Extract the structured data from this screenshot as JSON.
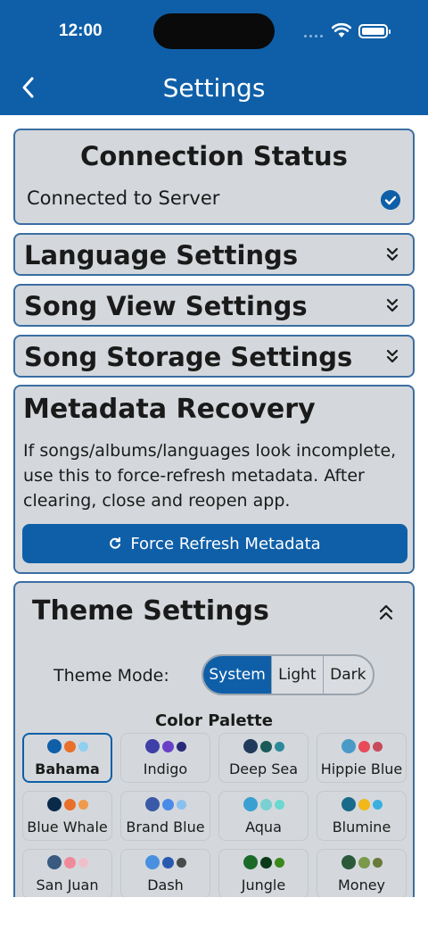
{
  "status_bar": {
    "time": "12:00"
  },
  "nav": {
    "title": "Settings",
    "back_icon": "chevron-left-icon"
  },
  "connection": {
    "title": "Connection Status",
    "status_text": "Connected to Server",
    "status_icon": "check-circle-icon"
  },
  "sections": {
    "language": "Language Settings",
    "song_view": "Song View Settings",
    "song_storage": "Song Storage Settings"
  },
  "metadata": {
    "title": "Metadata Recovery",
    "description": "If songs/albums/languages look incomplete, use this to force-refresh metadata. After clearing, close and reopen app.",
    "button_label": "Force Refresh Metadata",
    "button_icon": "refresh-icon"
  },
  "theme": {
    "title": "Theme Settings",
    "mode_label": "Theme Mode:",
    "modes": [
      "System",
      "Light",
      "Dark"
    ],
    "selected_mode": "System",
    "palette_label": "Color Palette",
    "selected_palette": "Bahama",
    "palettes": [
      {
        "name": "Bahama",
        "colors": [
          "#0f5fa8",
          "#e8702a",
          "#8fd0f0"
        ]
      },
      {
        "name": "Indigo",
        "colors": [
          "#3f3fa8",
          "#6a3fc8",
          "#2a2a7a"
        ]
      },
      {
        "name": "Deep Sea",
        "colors": [
          "#1f3a5a",
          "#1c5a5a",
          "#2a8a9a"
        ]
      },
      {
        "name": "Hippie Blue",
        "colors": [
          "#4a9ac8",
          "#e84a5a",
          "#c84a5a"
        ]
      },
      {
        "name": "Blue Whale",
        "colors": [
          "#0a2a4a",
          "#e8702a",
          "#f09a4a"
        ]
      },
      {
        "name": "Brand Blue",
        "colors": [
          "#3a5aa8",
          "#4a8ae8",
          "#8ac0f0"
        ]
      },
      {
        "name": "Aqua",
        "colors": [
          "#3aa0d0",
          "#7ad0d0",
          "#6ad8d0"
        ]
      },
      {
        "name": "Blumine",
        "colors": [
          "#1a6a8a",
          "#f0b81a",
          "#3ab0e0"
        ]
      },
      {
        "name": "San Juan",
        "colors": [
          "#3a5a80",
          "#f08a9a",
          "#f0c0c8"
        ]
      },
      {
        "name": "Dash",
        "colors": [
          "#4a90e0",
          "#2a5ab0",
          "#4a4a4a"
        ]
      },
      {
        "name": "Jungle",
        "colors": [
          "#1a6a2a",
          "#0a3a1a",
          "#3a8a1a"
        ]
      },
      {
        "name": "Money",
        "colors": [
          "#2a5a3a",
          "#7a9a4a",
          "#6a7a3a"
        ]
      }
    ]
  }
}
